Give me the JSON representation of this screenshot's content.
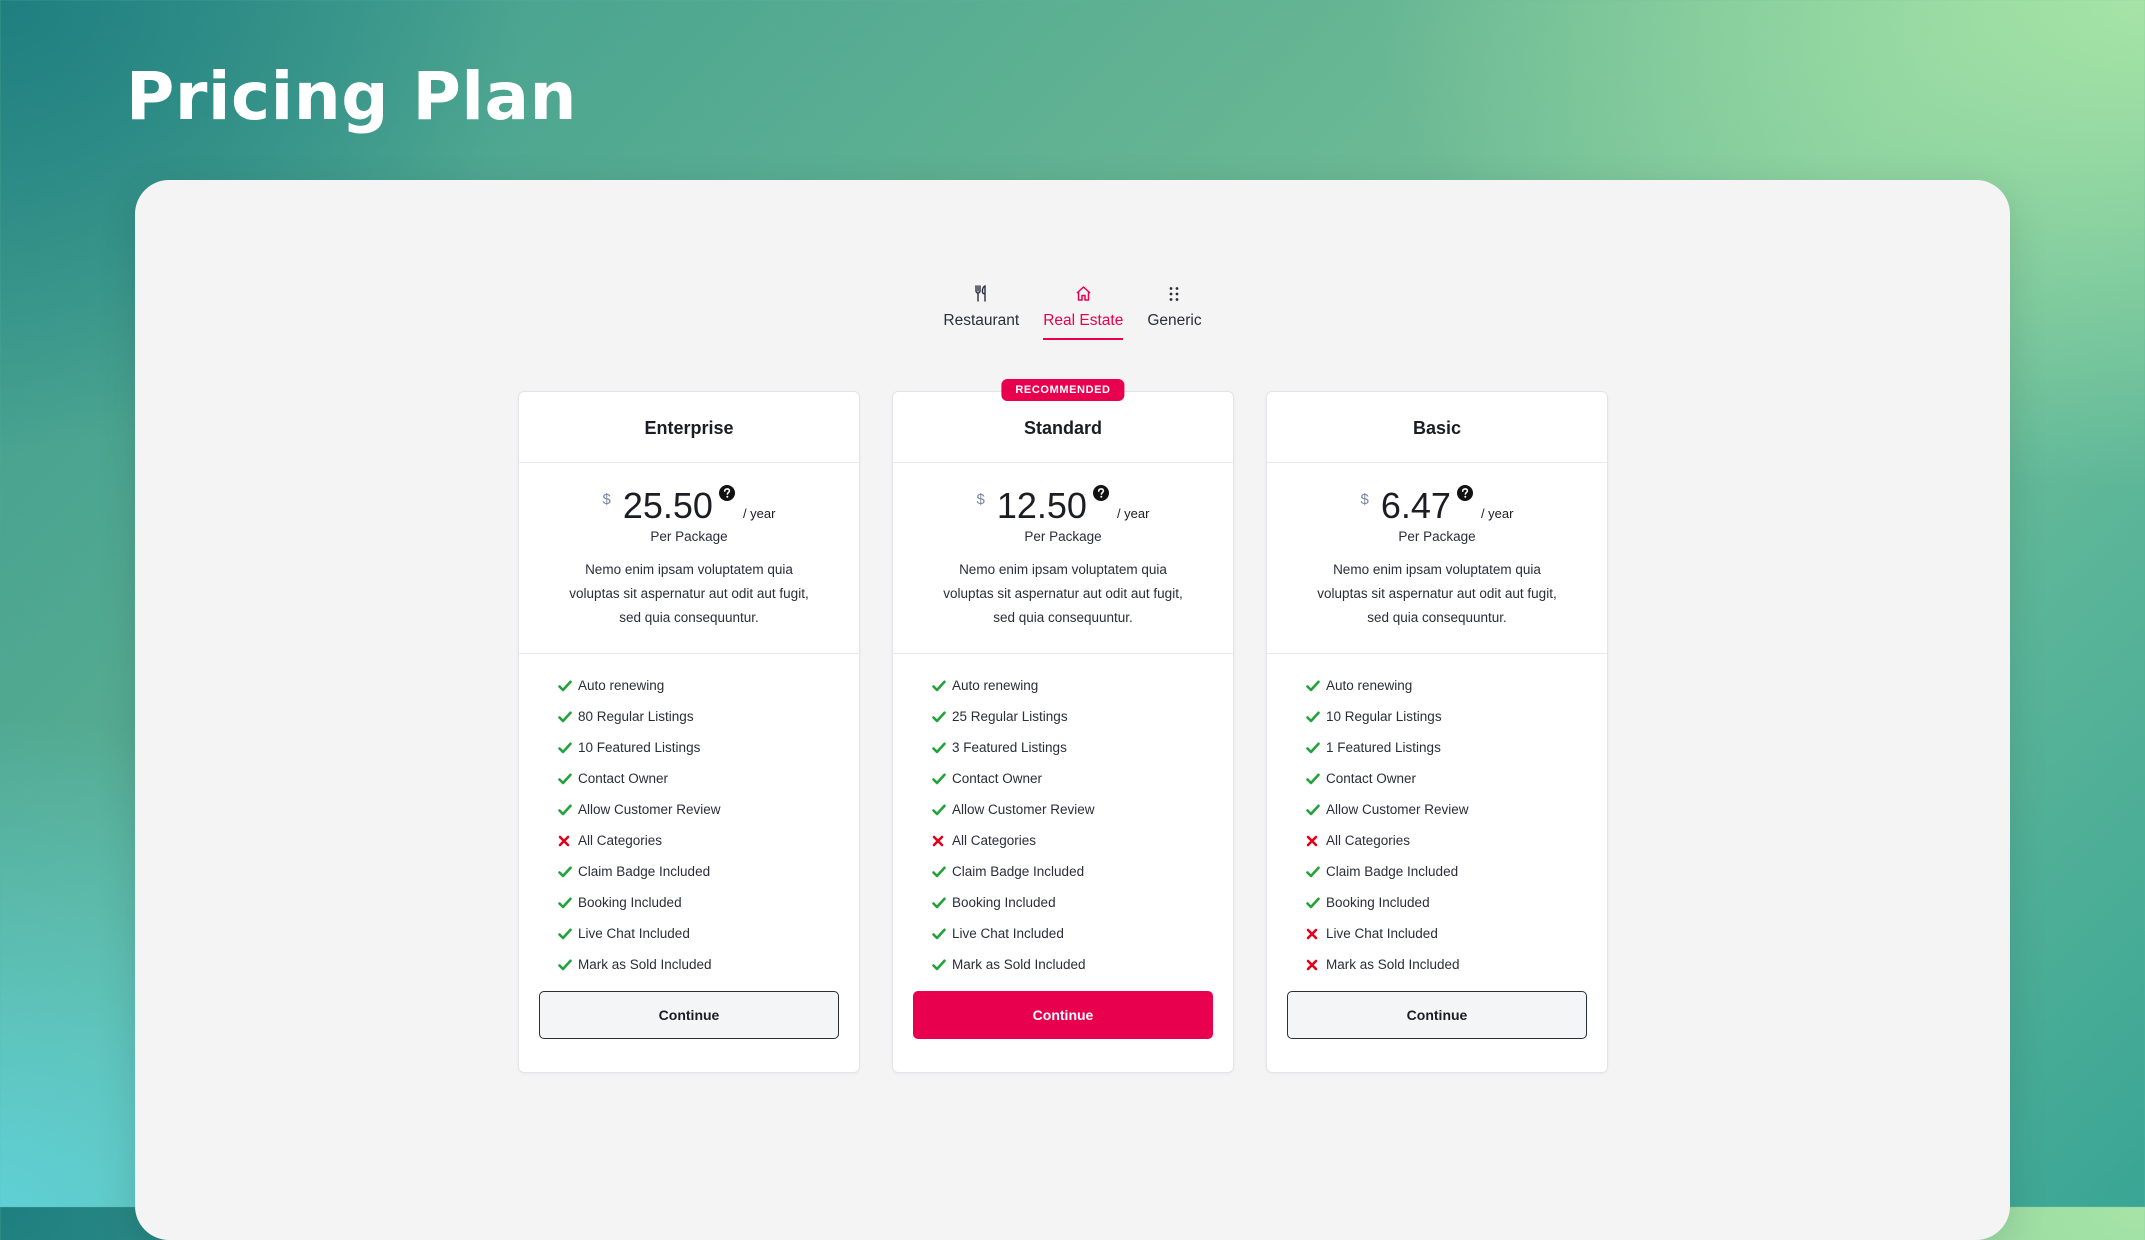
{
  "page_title": "Pricing Plan",
  "colors": {
    "accent": "#e8004f",
    "check": "#22a33a",
    "cross": "#e3001b",
    "text": "#1b1c24"
  },
  "tabs": [
    {
      "label": "Restaurant",
      "icon": "fork-knife-icon",
      "active": false
    },
    {
      "label": "Real Estate",
      "icon": "home-icon",
      "active": true
    },
    {
      "label": "Generic",
      "icon": "grid-dots-icon",
      "active": false
    }
  ],
  "plans": [
    {
      "name": "Enterprise",
      "badge": "",
      "currency": "$",
      "price": "25.50",
      "period": "/ year",
      "per": "Per Package",
      "description": "Nemo enim ipsam voluptatem quia voluptas sit aspernatur aut odit aut fugit, sed quia consequuntur.",
      "features": [
        {
          "label": "Auto renewing",
          "included": true
        },
        {
          "label": "80 Regular Listings",
          "included": true
        },
        {
          "label": "10 Featured Listings",
          "included": true
        },
        {
          "label": "Contact Owner",
          "included": true
        },
        {
          "label": "Allow Customer Review",
          "included": true
        },
        {
          "label": "All Categories",
          "included": false
        },
        {
          "label": "Claim Badge Included",
          "included": true
        },
        {
          "label": "Booking Included",
          "included": true
        },
        {
          "label": "Live Chat Included",
          "included": true
        },
        {
          "label": "Mark as Sold Included",
          "included": true
        }
      ],
      "button_label": "Continue",
      "button_style": "outline"
    },
    {
      "name": "Standard",
      "badge": "RECOMMENDED",
      "currency": "$",
      "price": "12.50",
      "period": "/ year",
      "per": "Per Package",
      "description": "Nemo enim ipsam voluptatem quia voluptas sit aspernatur aut odit aut fugit, sed quia consequuntur.",
      "features": [
        {
          "label": "Auto renewing",
          "included": true
        },
        {
          "label": "25 Regular Listings",
          "included": true
        },
        {
          "label": "3 Featured Listings",
          "included": true
        },
        {
          "label": "Contact Owner",
          "included": true
        },
        {
          "label": "Allow Customer Review",
          "included": true
        },
        {
          "label": "All Categories",
          "included": false
        },
        {
          "label": "Claim Badge Included",
          "included": true
        },
        {
          "label": "Booking Included",
          "included": true
        },
        {
          "label": "Live Chat Included",
          "included": true
        },
        {
          "label": "Mark as Sold Included",
          "included": true
        }
      ],
      "button_label": "Continue",
      "button_style": "filled"
    },
    {
      "name": "Basic",
      "badge": "",
      "currency": "$",
      "price": "6.47",
      "period": "/ year",
      "per": "Per Package",
      "description": "Nemo enim ipsam voluptatem quia voluptas sit aspernatur aut odit aut fugit, sed quia consequuntur.",
      "features": [
        {
          "label": "Auto renewing",
          "included": true
        },
        {
          "label": "10 Regular Listings",
          "included": true
        },
        {
          "label": "1 Featured Listings",
          "included": true
        },
        {
          "label": "Contact Owner",
          "included": true
        },
        {
          "label": "Allow Customer Review",
          "included": true
        },
        {
          "label": "All Categories",
          "included": false
        },
        {
          "label": "Claim Badge Included",
          "included": true
        },
        {
          "label": "Booking Included",
          "included": true
        },
        {
          "label": "Live Chat Included",
          "included": false
        },
        {
          "label": "Mark as Sold Included",
          "included": false
        }
      ],
      "button_label": "Continue",
      "button_style": "outline"
    }
  ]
}
